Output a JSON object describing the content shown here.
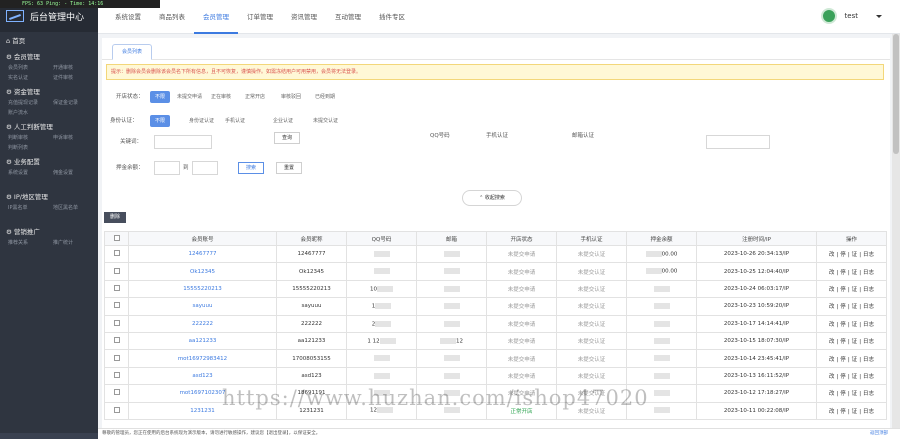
{
  "fps_bar": "FPS: 63   Ping: -   Time: 14:16",
  "app_title": "后台管理中心",
  "sidebar": {
    "home": "首页",
    "groups": [
      {
        "title": "会员管理",
        "items": [
          "会员列表",
          "开通审核",
          "实名认证",
          "证件审核"
        ]
      },
      {
        "title": "资金管理",
        "items": [
          "充值提现记录",
          "保证金记录",
          "账户流水",
          ""
        ]
      },
      {
        "title": "人工判断管理",
        "items": [
          "判断审核",
          "申诉审核",
          "判断列表",
          ""
        ]
      },
      {
        "title": "业务配置",
        "items": [
          "系统设置",
          "佣金设置",
          "",
          ""
        ]
      },
      {
        "title": "IP/地区管理",
        "items": [
          "IP黑名单",
          "地区黑名单",
          "",
          ""
        ]
      },
      {
        "title": "营销推广",
        "items": [
          "推荐关系",
          "推广统计",
          "",
          ""
        ]
      }
    ]
  },
  "topnav": [
    "系统设置",
    "商品列表",
    "会员管理",
    "订单管理",
    "资讯管理",
    "互动管理",
    "插件专区"
  ],
  "topnav_active_index": 2,
  "user": {
    "name": "test"
  },
  "tab_label": "会员列表",
  "notice": "提示：删除会员会删除该会员名下所有信息，且不可恢复，谨慎操作。如需冻结用户可用禁用，会员将无法登录。",
  "filters": {
    "status_label": "开店状态：",
    "status_options": [
      "不限",
      "未提交申请",
      "正在审核",
      "正常开店",
      "审核驳回",
      "已经到期"
    ],
    "auth_label": "身份认证：",
    "auth_options": [
      "不限",
      "身份证认证",
      "手机认证",
      "企业认证",
      "未提交认证"
    ],
    "keyword_label": "关键词：",
    "keyword_button": "查询",
    "col_qq": "QQ号码",
    "col_mobile": "手机认证",
    "col_email": "邮箱认证",
    "deposit_label": "押金余额：",
    "range_to": "到",
    "search_button": "搜索",
    "reset_button": "重置"
  },
  "toggle_search": "收起搜索",
  "bulk_button": "删除",
  "table": {
    "headers": [
      "会员账号",
      "会员昵称",
      "QQ号码",
      "邮箱",
      "开店状态",
      "手机认证",
      "押金余额",
      "注册时间/IP",
      "操作"
    ],
    "rows": [
      {
        "account": "12467777",
        "nick": "12467777",
        "qq": "",
        "email": "",
        "shop": "未提交申请",
        "mobile": "未提交认证",
        "deposit": "00.00",
        "time": "2023-10-26 20:34:13/IP"
      },
      {
        "account": "Ok12345",
        "nick": "Ok12345",
        "qq": "",
        "email": "",
        "shop": "未提交申请",
        "mobile": "未提交认证",
        "deposit": "00.00",
        "time": "2023-10-25 12:04:40/IP"
      },
      {
        "account": "15555220213",
        "nick": "15555220213",
        "qq": "10",
        "email": "",
        "shop": "未提交申请",
        "mobile": "未提交认证",
        "deposit": "",
        "time": "2023-10-24 06:03:17/IP"
      },
      {
        "account": "sayuuu",
        "nick": "sayuuu",
        "qq": "1",
        "email": "",
        "shop": "未提交申请",
        "mobile": "未提交认证",
        "deposit": "",
        "time": "2023-10-23 10:59:20/IP"
      },
      {
        "account": "222222",
        "nick": "222222",
        "qq": "2",
        "email": "",
        "shop": "未提交申请",
        "mobile": "未提交认证",
        "deposit": "",
        "time": "2023-10-17 14:14:41/IP"
      },
      {
        "account": "aa121233",
        "nick": "aa121233",
        "qq": "1 12",
        "email": "12",
        "shop": "未提交申请",
        "mobile": "未提交认证",
        "deposit": "",
        "time": "2023-10-15 18:07:30/IP"
      },
      {
        "account": "mot16972983412",
        "nick": "17008053155",
        "qq": "",
        "email": "",
        "shop": "未提交申请",
        "mobile": "未提交认证",
        "deposit": "",
        "time": "2023-10-14 23:45:41/IP"
      },
      {
        "account": "asd123",
        "nick": "asd123",
        "qq": "",
        "email": "",
        "shop": "未提交申请",
        "mobile": "未提交认证",
        "deposit": "",
        "time": "2023-10-13 16:11:52/IP"
      },
      {
        "account": "mot1697102307",
        "nick": "18691191",
        "qq": "",
        "email": "",
        "shop": "未提交申请",
        "mobile": "未提交认证",
        "deposit": "",
        "time": "2023-10-12 17:18:27/IP"
      },
      {
        "account": "1231231",
        "nick": "1231231",
        "qq": "12",
        "email": "",
        "shop": "正常开店",
        "mobile": "未提交认证",
        "deposit": "",
        "time": "2023-10-11 00:22:08/IP"
      }
    ],
    "ops": [
      "改",
      "停",
      "证",
      "日志"
    ]
  },
  "watermark": "https://www.huzhan.com/ishop47020",
  "statusbar": {
    "text": "尊敬的管理员，您正在使用的后台系统现为演示版本，请勿进行敏感操作，建议您【退出登录】，以保证安全。",
    "right": "返回顶部"
  }
}
